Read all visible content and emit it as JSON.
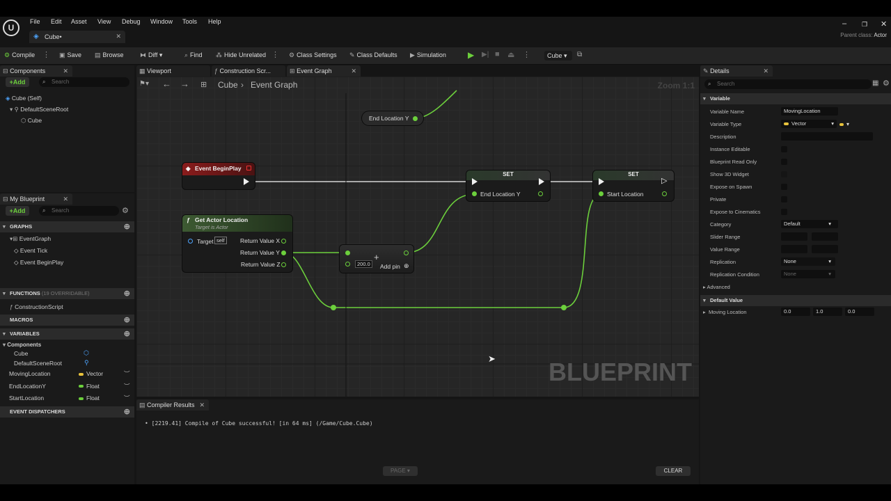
{
  "menu": [
    "File",
    "Edit",
    "Asset",
    "View",
    "Debug",
    "Window",
    "Tools",
    "Help"
  ],
  "doc_tab": "Cube•",
  "parent_class": {
    "label": "Parent class:",
    "value": "Actor"
  },
  "toolbar": {
    "compile": "Compile",
    "save": "Save",
    "browse": "Browse",
    "diff": "Diff",
    "find": "Find",
    "hide_unrelated": "Hide Unrelated",
    "class_settings": "Class Settings",
    "class_defaults": "Class Defaults",
    "simulation": "Simulation",
    "debug_object": "Cube"
  },
  "components_panel": {
    "title": "Components",
    "add": "Add",
    "search_placeholder": "Search",
    "tree": [
      "Cube (Self)",
      "DefaultSceneRoot",
      "Cube"
    ]
  },
  "my_blueprint": {
    "title": "My Blueprint",
    "add": "Add",
    "search_placeholder": "Search",
    "graphs_label": "GRAPHS",
    "graphs": [
      "EventGraph",
      "Event Tick",
      "Event BeginPlay"
    ],
    "functions_label": "FUNCTIONS",
    "functions_sub": "(19 OVERRIDABLE)",
    "functions": [
      "ConstructionScript"
    ],
    "macros_label": "MACROS",
    "variables_label": "VARIABLES",
    "components_group": "Components",
    "component_vars": [
      "Cube",
      "DefaultSceneRoot"
    ],
    "variables": [
      {
        "name": "MovingLocation",
        "type": "Vector",
        "color": "#e8c23c"
      },
      {
        "name": "EndLocationY",
        "type": "Float",
        "color": "#6ccf3c"
      },
      {
        "name": "StartLocation",
        "type": "Float",
        "color": "#6ccf3c"
      }
    ],
    "dispatchers_label": "EVENT DISPATCHERS"
  },
  "graph_tabs": [
    "Viewport",
    "Construction Scr...",
    "Event Graph"
  ],
  "breadcrumb": {
    "root": "Cube",
    "current": "Event Graph"
  },
  "zoom_label": "Zoom 1:1",
  "watermark": "BLUEPRINT",
  "nodes": {
    "end_location_get": "End Location Y",
    "begin_play": "Event BeginPlay",
    "get_actor_location": {
      "title": "Get Actor Location",
      "subtitle": "Target is Actor",
      "target": "Target",
      "self": "self",
      "outputs": [
        "Return Value X",
        "Return Value Y",
        "Return Value Z"
      ]
    },
    "add": {
      "value": "200.0",
      "add_pin": "Add pin"
    },
    "set1": {
      "title": "SET",
      "pin": "End Location Y"
    },
    "set2": {
      "title": "SET",
      "pin": "Start Location"
    }
  },
  "details": {
    "title": "Details",
    "search_placeholder": "Search",
    "variable_section": "Variable",
    "rows": {
      "variable_name": {
        "label": "Variable Name",
        "value": "MovingLocation"
      },
      "variable_type": {
        "label": "Variable Type",
        "value": "Vector"
      },
      "description": {
        "label": "Description"
      },
      "instance_editable": {
        "label": "Instance Editable"
      },
      "blueprint_read_only": {
        "label": "Blueprint Read Only"
      },
      "show_3d_widget": {
        "label": "Show 3D Widget"
      },
      "expose_on_spawn": {
        "label": "Expose on Spawn"
      },
      "private": {
        "label": "Private"
      },
      "expose_cinematics": {
        "label": "Expose to Cinematics"
      },
      "category": {
        "label": "Category",
        "value": "Default"
      },
      "slider_range": {
        "label": "Slider Range"
      },
      "value_range": {
        "label": "Value Range"
      },
      "replication": {
        "label": "Replication",
        "value": "None"
      },
      "replication_condition": {
        "label": "Replication Condition",
        "value": "None"
      },
      "advanced": {
        "label": "Advanced"
      }
    },
    "default_value_section": "Default Value",
    "moving_location": {
      "label": "Moving Location",
      "x": "0.0",
      "y": "1.0",
      "z": "0.0"
    }
  },
  "compiler": {
    "title": "Compiler Results",
    "message": "[2219.41] Compile of Cube successful! [in 64 ms] (/Game/Cube.Cube)",
    "page": "PAGE",
    "clear": "CLEAR"
  },
  "colors": {
    "exec_white": "#eeeeee",
    "float_green": "#6ccf3c",
    "event_red": "#8a1c1c",
    "vector_yellow": "#e8c23c"
  }
}
